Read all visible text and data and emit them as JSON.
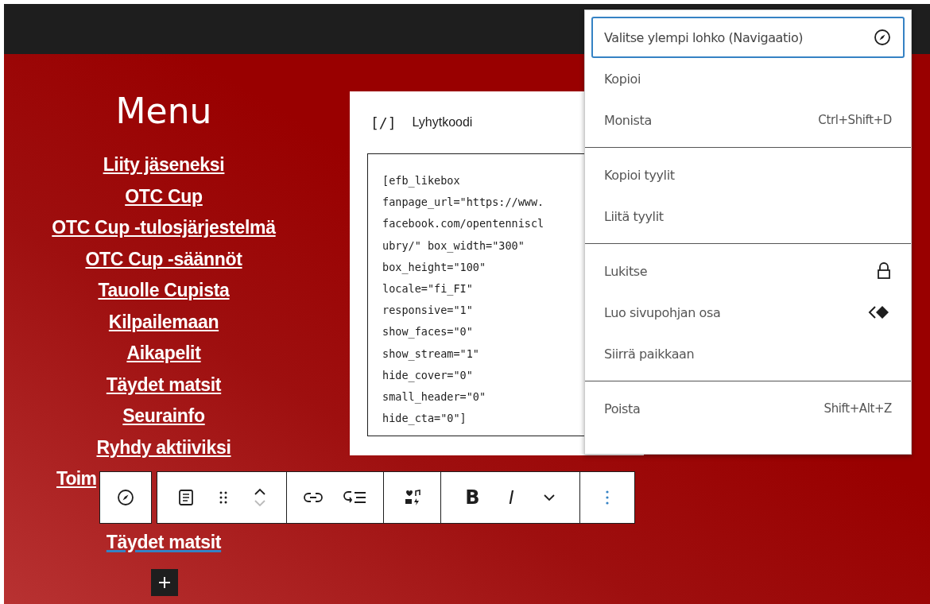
{
  "menu": {
    "heading": "Menu",
    "items": [
      {
        "label": "Liity jäseneksi",
        "kind": "link",
        "selected": false
      },
      {
        "label": "OTC Cup",
        "kind": "link",
        "selected": false
      },
      {
        "label": "OTC Cup -tulosjärjestelmä",
        "kind": "link",
        "selected": false
      },
      {
        "label": "OTC Cup -säännöt",
        "kind": "link",
        "selected": false
      },
      {
        "label": "Tauolle Cupista",
        "kind": "link",
        "selected": false
      },
      {
        "label": "Kilpailemaan",
        "kind": "link",
        "selected": false
      },
      {
        "label": "Aikapelit",
        "kind": "link",
        "selected": false
      },
      {
        "label": "Täydet matsit",
        "kind": "link",
        "selected": false
      },
      {
        "label": "Seurainfo",
        "kind": "link",
        "selected": false
      },
      {
        "label": "Ryhdy aktiiviksi",
        "kind": "link",
        "selected": false
      },
      {
        "label": "Toim",
        "kind": "partial",
        "selected": false
      },
      {
        "label": "Täydet matsit",
        "kind": "link",
        "selected": true
      }
    ]
  },
  "shortcode": {
    "title": "Lyhytkoodi",
    "icon_text": "[/]",
    "lines": [
      "[efb_likebox",
      "fanpage_url=\"https://www.",
      "facebook.com/opentenniscl",
      "ubry/\" box_width=\"300\"",
      "box_height=\"100\"",
      "locale=\"fi_FI\"",
      "responsive=\"1\"",
      "show_faces=\"0\"",
      "show_stream=\"1\"",
      "hide_cover=\"0\"",
      "small_header=\"0\"",
      "hide_cta=\"0\"]"
    ]
  },
  "dropdown": {
    "sections": [
      [
        {
          "label": "Valitse ylempi lohko (Navigaatio)",
          "kind": "select-parent",
          "selected": true
        },
        {
          "label": "Kopioi",
          "kind": "plain",
          "selected": false
        },
        {
          "label": "Monista",
          "kind": "shortcut",
          "shortcut": "Ctrl+Shift+D",
          "selected": false
        }
      ],
      [
        {
          "label": "Kopioi tyylit",
          "kind": "plain",
          "selected": false
        },
        {
          "label": "Liitä tyylit",
          "kind": "plain",
          "selected": false
        }
      ],
      [
        {
          "label": "Lukitse",
          "kind": "lock",
          "selected": false
        },
        {
          "label": "Luo sivupohjan osa",
          "kind": "pattern",
          "selected": false
        },
        {
          "label": "Siirrä paikkaan",
          "kind": "plain",
          "selected": false
        }
      ],
      [
        {
          "label": "Poista",
          "kind": "shortcut",
          "shortcut": "Shift+Alt+Z",
          "selected": false
        }
      ]
    ]
  },
  "toolbar": {
    "bold": "B",
    "italic": "I"
  }
}
